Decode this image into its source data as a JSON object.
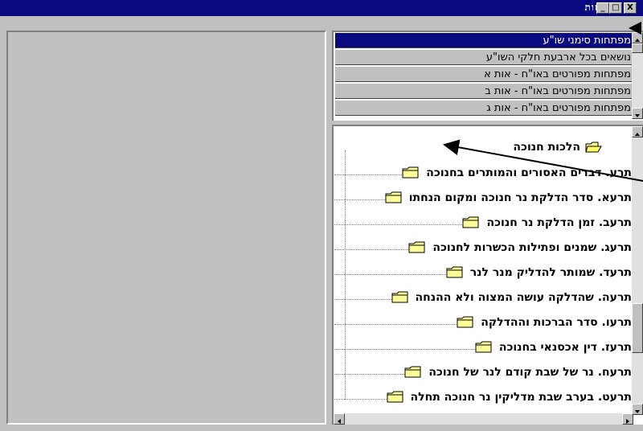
{
  "window": {
    "title": "מפתחות",
    "minimize_glyph": "_",
    "maximize_glyph": "□",
    "close_glyph": "X"
  },
  "list": {
    "items": [
      {
        "label": "מפתחות סימני שו\"ע",
        "selected": true
      },
      {
        "label": "נושאים בכל ארבעת חלקי השו\"ע",
        "selected": false
      },
      {
        "label": "מפתחות מפורטים באו\"ח - אות א",
        "selected": false
      },
      {
        "label": "מפתחות מפורטים באו\"ח - אות ב",
        "selected": false
      },
      {
        "label": "מפתחות מפורטים באו\"ח - אות ג",
        "selected": false
      }
    ]
  },
  "tree": {
    "root": {
      "label": "הלכות חנוכה",
      "icon": "open-folder-icon"
    },
    "children": [
      {
        "label": "תרע. דברים האסורים והמותרים בחנוכה"
      },
      {
        "label": "תרעא. סדר הדלקת נר חנוכה ומקום הנחתו"
      },
      {
        "label": "תרעב. זמן הדלקת נר חנוכה"
      },
      {
        "label": "תרעג. שמנים ופתילות הכשרות לחנוכה"
      },
      {
        "label": "תרעד. שמותר להדליק מנר לנר"
      },
      {
        "label": "תרעה. שהדלקה עושה המצוה ולא ההנחה"
      },
      {
        "label": "תרעו. סדר הברכות וההדלקה"
      },
      {
        "label": "תרעז. דין אכסנאי בחנוכה"
      },
      {
        "label": "תרעח. נר של שבת קודם לנר של חנוכה"
      },
      {
        "label": "תרעט. בערב שבת מדליקין נר חנוכה תחלה"
      }
    ]
  },
  "colors": {
    "titlebar": "#0a0a80",
    "face": "#c0c0c0",
    "folder": "#ffff99"
  }
}
